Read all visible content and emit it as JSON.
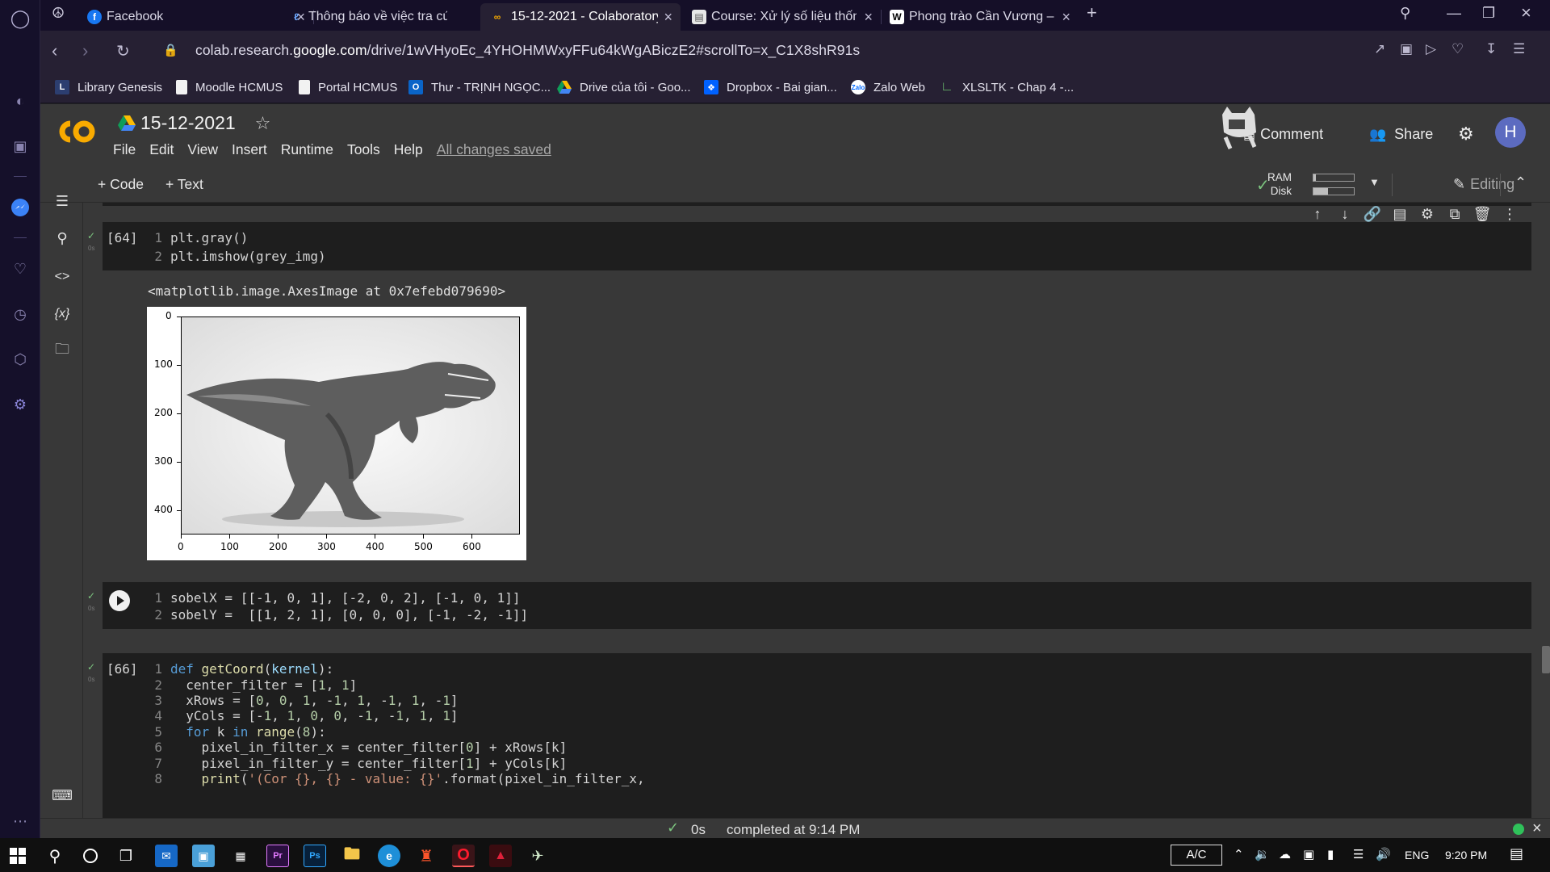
{
  "browser": {
    "tabs": [
      {
        "label": "Facebook",
        "favicon": "facebook-icon",
        "active": false
      },
      {
        "label": "Thông báo về việc tra cứu k",
        "favicon": "ctu-icon",
        "active": false
      },
      {
        "label": "15-12-2021 - Colaboratory",
        "favicon": "colab-icon",
        "active": true
      },
      {
        "label": "Course: Xử lý số liệu thống",
        "favicon": "moodle-icon",
        "active": false
      },
      {
        "label": "Phong trào Cần Vương – W",
        "favicon": "wikipedia-icon",
        "active": false
      }
    ],
    "url_prefix": "colab.research.",
    "url_host": "google.com",
    "url_rest": "/drive/1wVHyoEc_4YHOHMWxyFFu64kWgABiczE2#scrollTo=x_C1X8shR91s",
    "bookmarks": [
      {
        "label": "Library Genesis",
        "icon": "library-genesis-icon"
      },
      {
        "label": "Moodle HCMUS",
        "icon": "page-icon"
      },
      {
        "label": "Portal HCMUS",
        "icon": "page-icon"
      },
      {
        "label": "Thư - TRỊNH NGỌC...",
        "icon": "outlook-icon"
      },
      {
        "label": "Drive của tôi - Goo...",
        "icon": "drive-icon"
      },
      {
        "label": "Dropbox - Bai gian...",
        "icon": "dropbox-icon"
      },
      {
        "label": "Zalo Web",
        "icon": "zalo-icon"
      },
      {
        "label": "XLSLTK - Chap 4 -...",
        "icon": "moodle-icon"
      }
    ]
  },
  "colab": {
    "title": "15-12-2021",
    "menu": [
      "File",
      "Edit",
      "View",
      "Insert",
      "Runtime",
      "Tools",
      "Help"
    ],
    "saved_status": "All changes saved",
    "comment_label": "Comment",
    "share_label": "Share",
    "avatar_letter": "H",
    "toolbar": {
      "code_label": "Code",
      "text_label": "Text",
      "ram_label": "RAM",
      "disk_label": "Disk",
      "ram_fraction": 0.05,
      "disk_fraction": 0.35,
      "editing_label": "Editing"
    }
  },
  "cells": {
    "cell64": {
      "count": "[64]",
      "duration": "0s",
      "lines": [
        "plt.gray()",
        "plt.imshow(grey_img)"
      ],
      "output_text": "<matplotlib.image.AxesImage at 0x7efebd079690>",
      "plot": {
        "y_ticks": [
          "0",
          "100",
          "200",
          "300",
          "400"
        ],
        "x_ticks": [
          "0",
          "100",
          "200",
          "300",
          "400",
          "500",
          "600"
        ]
      }
    },
    "cell_sobel": {
      "duration": "0s",
      "line1": "sobelX = [[-1, 0, 1], [-2, 0, 2], [-1, 0, 1]]",
      "line2": "sobelY =  [[1, 2, 1], [0, 0, 0], [-1, -2, -1]]"
    },
    "cell66": {
      "count": "[66]",
      "duration": "0s"
    }
  },
  "status": {
    "elapsed": "0s",
    "message": "completed at 9:14 PM"
  },
  "taskbar": {
    "ac_label": "A/C",
    "lang": "ENG",
    "time": "9:20 PM"
  }
}
